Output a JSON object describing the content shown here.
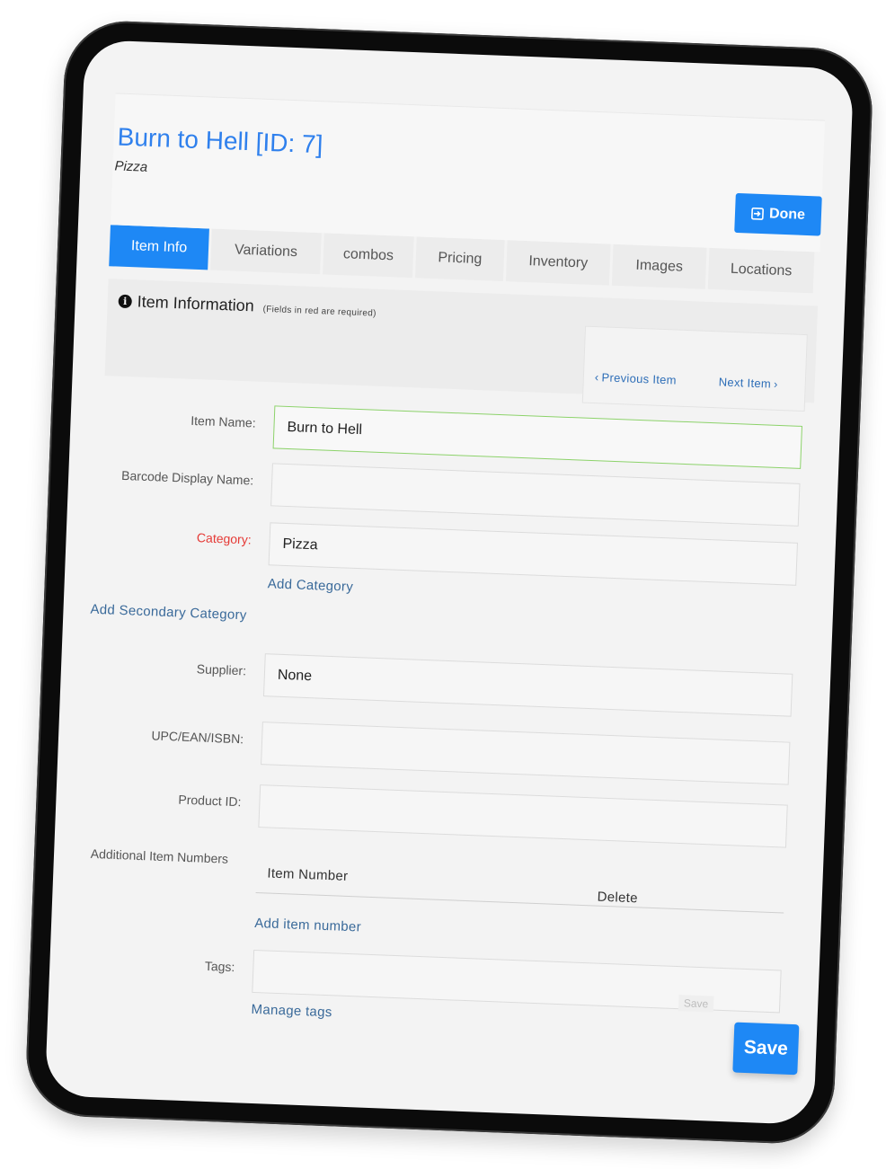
{
  "header": {
    "title": "Burn to Hell [ID: 7]",
    "subtitle": "Pizza",
    "done_label": "Done"
  },
  "tabs": [
    {
      "label": "Item Info",
      "active": true
    },
    {
      "label": "Variations",
      "active": false
    },
    {
      "label": "combos",
      "active": false
    },
    {
      "label": "Pricing",
      "active": false
    },
    {
      "label": "Inventory",
      "active": false
    },
    {
      "label": "Images",
      "active": false
    },
    {
      "label": "Locations",
      "active": false
    }
  ],
  "info": {
    "heading": "Item Information",
    "note": "(Fields in red are required)",
    "previous_label": "Previous Item",
    "next_label": "Next Item"
  },
  "form": {
    "item_name_label": "Item Name:",
    "item_name_value": "Burn to Hell",
    "barcode_label": "Barcode Display Name:",
    "barcode_value": "",
    "category_label": "Category:",
    "category_value": "Pizza",
    "add_category": "Add Category",
    "add_secondary_category": "Add Secondary Category",
    "supplier_label": "Supplier:",
    "supplier_value": "None",
    "upc_label": "UPC/EAN/ISBN:",
    "upc_value": "",
    "product_id_label": "Product ID:",
    "product_id_value": "",
    "additional_label": "Additional Item Numbers",
    "col_item_number": "Item Number",
    "col_delete": "Delete",
    "add_item_number": "Add item number",
    "tags_label": "Tags:",
    "tags_value": "",
    "manage_tags": "Manage tags",
    "ghost_save": "Save",
    "save_label": "Save"
  },
  "colors": {
    "accent": "#1e88f5",
    "link": "#2f80ed",
    "required": "#e53935",
    "focus_border": "#8cd26a"
  }
}
